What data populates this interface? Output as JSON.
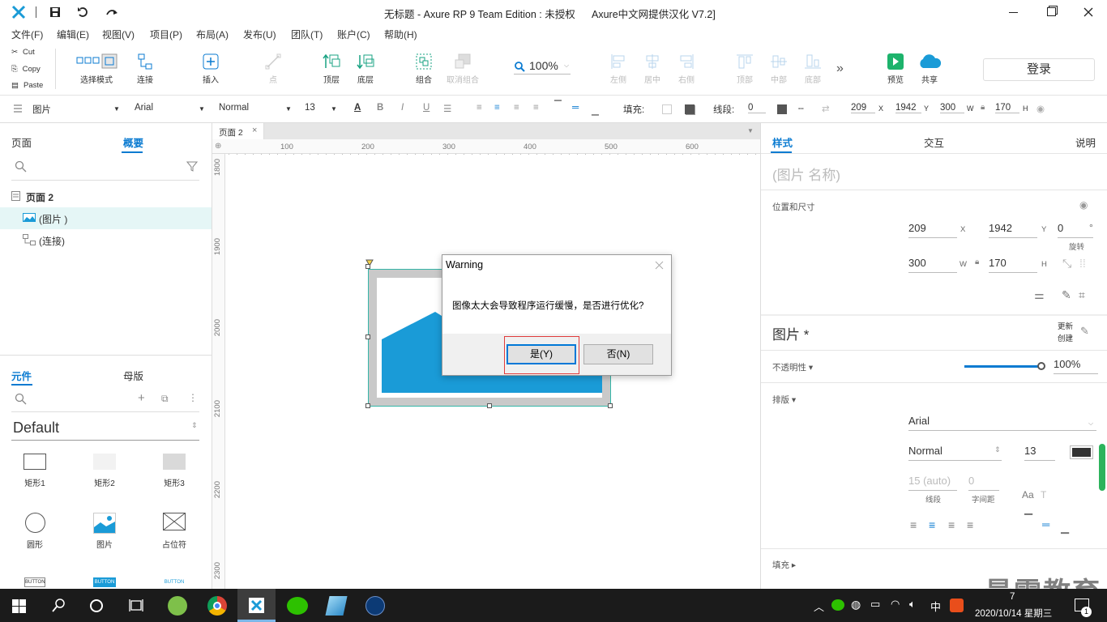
{
  "window": {
    "title": "无标题 - Axure RP 9 Team Edition : 未授权",
    "title_extra": "Axure中文网提供汉化 V7.2]"
  },
  "menu": [
    "文件(F)",
    "编辑(E)",
    "视图(V)",
    "项目(P)",
    "布局(A)",
    "发布(U)",
    "团队(T)",
    "账户(C)",
    "帮助(H)"
  ],
  "clipboard": {
    "cut": "Cut",
    "copy": "Copy",
    "paste": "Paste"
  },
  "toolbar": {
    "select_mode": "选择模式",
    "connect": "连接",
    "insert": "插入",
    "point": "点",
    "top": "顶层",
    "bottom": "底层",
    "group": "组合",
    "ungroup": "取消组合",
    "zoom": "100%",
    "align_left": "左侧",
    "align_center": "居中",
    "align_right": "右侧",
    "align_top": "顶部",
    "align_middle": "中部",
    "align_bottom": "底部",
    "preview": "预览",
    "share": "共享",
    "login": "登录"
  },
  "format": {
    "element_type": "图片",
    "font": "Arial",
    "weight": "Normal",
    "size": "13",
    "fill_label": "填充:",
    "stroke_label": "线段:",
    "stroke_value": "0",
    "x": "209",
    "x_l": "X",
    "y": "1942",
    "y_l": "Y",
    "w": "300",
    "w_l": "W",
    "h": "170",
    "h_l": "H"
  },
  "left": {
    "tab_pages": "页面",
    "tab_outline": "概要",
    "page_name": "页面 2",
    "items": [
      "(图片 )",
      "(连接)"
    ],
    "tab_widgets": "元件",
    "tab_masters": "母版",
    "library": "Default",
    "widgets": [
      "矩形1",
      "矩形2",
      "矩形3",
      "圆形",
      "图片",
      "占位符"
    ],
    "buttons": [
      "BUTTON",
      "BUTTON",
      "BUTTON"
    ]
  },
  "canvas": {
    "tab": "页面 2",
    "hticks": [
      "100",
      "200",
      "300",
      "400",
      "500",
      "600"
    ],
    "vticks": [
      "1800",
      "1900",
      "2000",
      "2100",
      "2200",
      "2300"
    ]
  },
  "dialog": {
    "title": "Warning",
    "message": "图像太大会导致程序运行缓慢，是否进行优化?",
    "yes": "是(Y)",
    "no": "否(N)"
  },
  "right": {
    "tab_style": "样式",
    "tab_interact": "交互",
    "tab_notes": "说明",
    "name_placeholder": "(图片 名称)",
    "pos_size": "位置和尺寸",
    "x": "209",
    "x_l": "X",
    "y": "1942",
    "y_l": "Y",
    "rot": "0",
    "rot_unit": "°",
    "rot_l": "旋转",
    "w": "300",
    "w_l": "W",
    "h": "170",
    "h_l": "H",
    "section_title": "图片 *",
    "update": "更新",
    "create": "创建",
    "opacity_label": "不透明性 ▾",
    "opacity": "100%",
    "typography": "排版 ▾",
    "font": "Arial",
    "weight": "Normal",
    "size": "13",
    "line_h": "15 (auto)",
    "line_h_l": "线段",
    "spacing": "0",
    "spacing_l": "字间距",
    "fill": "填充 ▸"
  },
  "watermark": "最需教育",
  "taskbar": {
    "ime": "中",
    "time": "7",
    "date": "2020/10/14 星期三",
    "notif": "1"
  },
  "colors": {
    "accent": "#0b7bd1",
    "image_blue": "#1a9bd7",
    "selection": "#35b6a8",
    "taskbar": "#1b1b1b"
  }
}
